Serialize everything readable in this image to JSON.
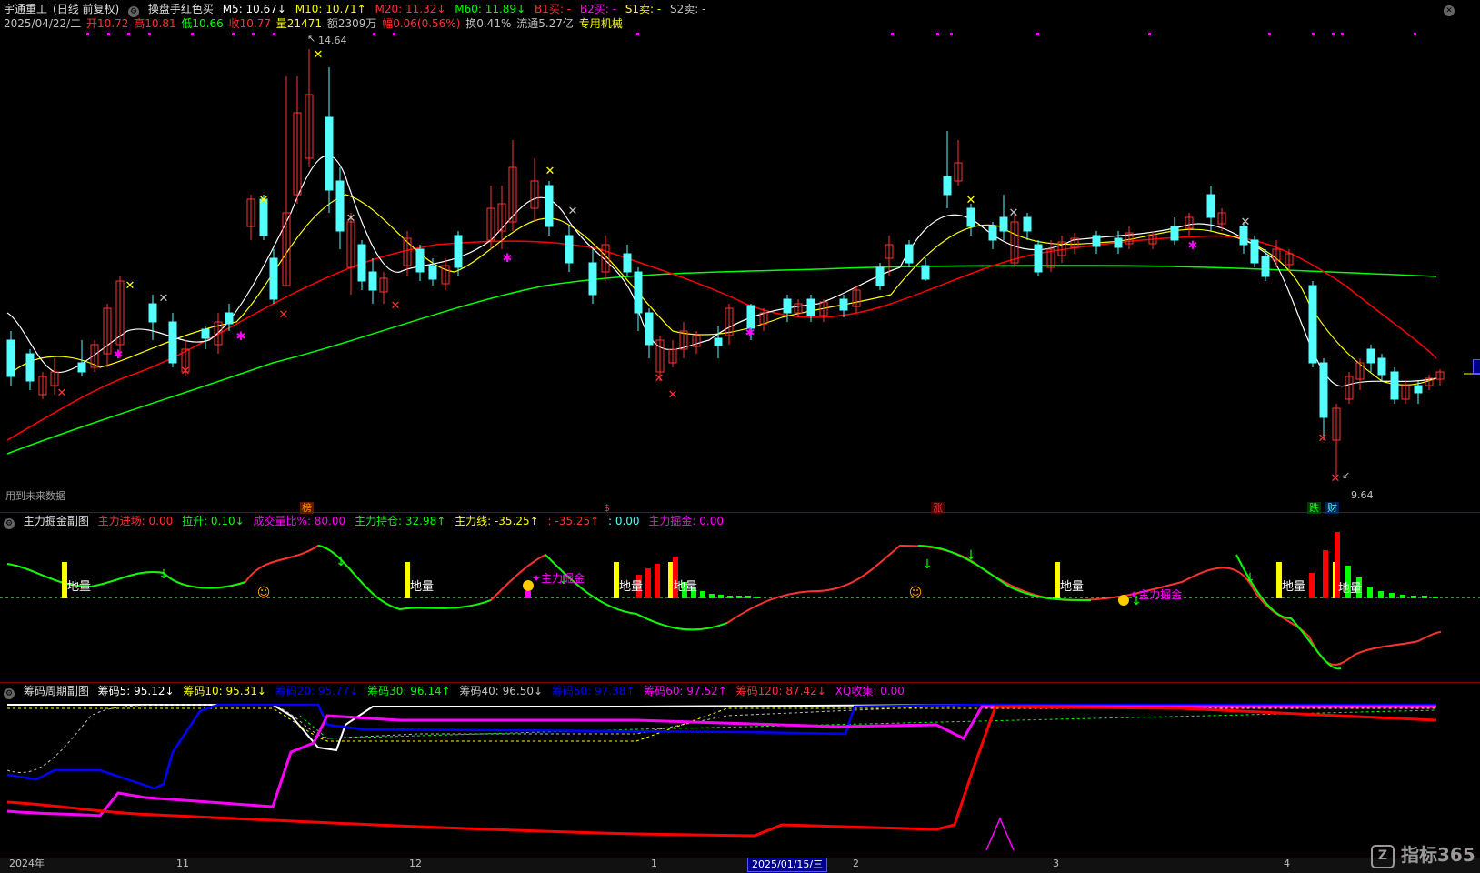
{
  "main": {
    "stock_name": "宇通重工",
    "period": "(日线 前复权)",
    "indicator_name": "操盘手红色买",
    "ma5": "M5: 10.67↓",
    "ma10": "M10: 10.71↑",
    "ma20": "M20: 11.32↓",
    "ma60": "M60: 11.89↓",
    "b1": "B1买: -",
    "b2": "B2买: -",
    "s1": "S1卖: -",
    "s2": "S2卖: -",
    "date": "2025/04/22/二",
    "open": "开10.72",
    "high": "高10.81",
    "low": "低10.66",
    "close": "收10.77",
    "volume": "量21471",
    "amount": "额2309万",
    "change": "幅0.06(0.56%)",
    "turnover": "换0.41%",
    "float": "流通5.27亿",
    "sector": "专用机械",
    "high_label": "14.64",
    "low_label": "9.64",
    "future_note": "用到未来数据",
    "marker_bang": "榜",
    "marker_s": "$",
    "marker_zhang": "涨",
    "marker_die": "跌",
    "marker_cai": "财"
  },
  "sub1": {
    "title": "主力掘金副图",
    "jinchang": "主力进场: 0.00",
    "lasheng": "拉升: 0.10↓",
    "volratio": "成交量比%: 80.00",
    "chicang": "主力持仓: 32.98↑",
    "xian": "主力线: -35.25↑",
    "v2": ": -35.25↑",
    "v3": ": 0.00",
    "juejin": "主力掘金: 0.00",
    "label_diliang": "地量",
    "label_juejin": "主力掘金"
  },
  "sub2": {
    "title": "筹码周期副图",
    "c5": "筹码5: 95.12↓",
    "c10": "筹码10: 95.31↓",
    "c20": "筹码20: 95.77↓",
    "c30": "筹码30: 96.14↑",
    "c40": "筹码40: 96.50↓",
    "c50": "筹码50: 97.38↑",
    "c60": "筹码60: 97.52↑",
    "c120": "筹码120: 87.42↓",
    "xq": "XQ收集: 0.00"
  },
  "axis": {
    "year": "2024年",
    "m11": "11",
    "m12": "12",
    "m1": "1",
    "cursor_date": "2025/01/15/三",
    "m2": "2",
    "m3": "3",
    "m4": "4"
  },
  "brand": "指标365",
  "colors": {
    "up": "#ff3232",
    "down": "#54ffff",
    "ma5": "#ffffff",
    "ma10": "#ffff00",
    "ma20": "#ff0000",
    "ma60": "#00ff00"
  }
}
